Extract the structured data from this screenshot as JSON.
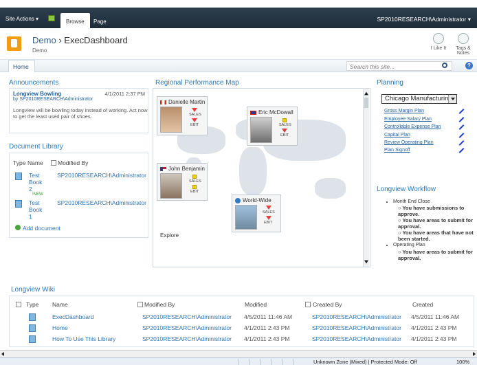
{
  "topbar": {
    "site_actions": "Site Actions ▾",
    "tabs": [
      "Browse",
      "Page"
    ],
    "user": "SP2010RESEARCH\\Administrator ▾"
  },
  "header": {
    "site": "Demo",
    "separator": "›",
    "page": "ExecDashboard",
    "subtitle": "Demo",
    "like_label": "I Like It",
    "tags_label": "Tags &",
    "tags_label2": "Notes"
  },
  "topnav": {
    "home": "Home",
    "search_placeholder": "Search this site...",
    "help": "?"
  },
  "announcements": {
    "title": "Announcements",
    "item_title": "Longview Bowling",
    "date": "4/1/2011 2:37 PM",
    "by": "by SP2010RESEARCH\\Administrator",
    "body": "Longview will be bowling today instead of working.  Act now to get the least used pair of shoes."
  },
  "doclib": {
    "title": "Document Library",
    "col_type": "Type",
    "col_name": "Name",
    "col_modified_by": "Modified By",
    "rows": [
      {
        "name_1": "Test",
        "name_2": "Book",
        "name_3": "2",
        "badge": "!NEW",
        "by": "SP2010RESEARCH\\Administrator"
      },
      {
        "name_1": "Test",
        "name_2": "Book",
        "name_3": "1",
        "badge": "",
        "by": "SP2010RESEARCH\\Administrator"
      }
    ],
    "add": "Add document"
  },
  "map": {
    "title": "Regional Performance Map",
    "explore": "Explore",
    "cards": [
      {
        "name": "Danielle Martin",
        "k1": "SALES",
        "k2": "EBIT"
      },
      {
        "name": "Eric McDowall",
        "k1": "SALES",
        "k2": "EBIT"
      },
      {
        "name": "John Benjamin",
        "k1": "SALES",
        "k2": "EBIT"
      },
      {
        "name": "World-Wide",
        "k1": "SALES",
        "k2": "EBIT"
      }
    ]
  },
  "planning": {
    "title": "Planning",
    "selected": "Chicago Manufacturing",
    "links": [
      "Gross Margin Plan",
      "Employee Salary Plan",
      "Controllable Expense Plan",
      "Capital Plan",
      "Review Operating Plan",
      "Plan Signoff"
    ]
  },
  "workflow": {
    "title": "Longview Workflow",
    "group1": "Month End Close",
    "item1": "You have submissions to approve.",
    "item2": "You have areas to submit for approval.",
    "item3": "You have areas that have not been started.",
    "group2": "Operating Plan",
    "item4": "You have areas to submit for approval."
  },
  "wiki": {
    "title": "Longview Wiki",
    "cols": {
      "type": "Type",
      "name": "Name",
      "modified_by": "Modified By",
      "modified": "Modified",
      "created_by": "Created By",
      "created": "Created"
    },
    "rows": [
      {
        "name": "ExecDashboard",
        "modified_by": "SP2010RESEARCH\\Administrator",
        "modified": "4/5/2011 11:46 AM",
        "created_by": "SP2010RESEARCH\\Administrator",
        "created": "4/5/2011 11:46 AM"
      },
      {
        "name": "Home",
        "modified_by": "SP2010RESEARCH\\Administrator",
        "modified": "4/1/2011 2:43 PM",
        "created_by": "SP2010RESEARCH\\Administrator",
        "created": "4/1/2011 2:43 PM"
      },
      {
        "name": "How To Use This Library",
        "modified_by": "SP2010RESEARCH\\Administrator",
        "modified": "4/1/2011 2:43 PM",
        "created_by": "SP2010RESEARCH\\Administrator",
        "created": "4/1/2011 2:43 PM"
      }
    ]
  },
  "status": {
    "zone": "Unknown Zone (Mixed) | Protected Mode: Off",
    "zoom": "100%"
  }
}
